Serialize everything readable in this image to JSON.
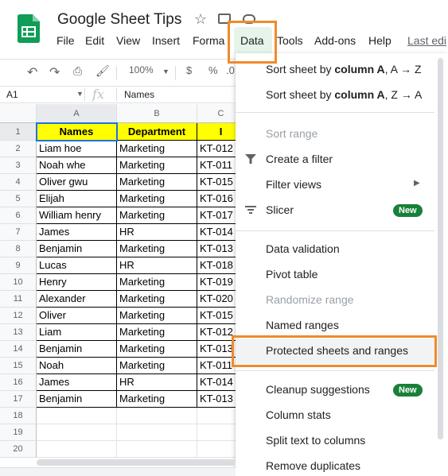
{
  "header": {
    "title": "Google Sheet Tips",
    "last_edit": "Last edi"
  },
  "menubar": {
    "items": [
      "File",
      "Edit",
      "View",
      "Insert",
      "Forma",
      "Data",
      "Tools",
      "Add-ons",
      "Help"
    ],
    "active": "Data"
  },
  "toolbar": {
    "zoom": "100%",
    "currency": "$",
    "percent": "%",
    "decimal": ".0"
  },
  "formula_bar": {
    "cell_ref": "A1",
    "fx": "fx",
    "value": "Names"
  },
  "sheet": {
    "columns": [
      "A",
      "B",
      "C"
    ],
    "row_numbers": [
      "1",
      "2",
      "3",
      "4",
      "5",
      "6",
      "7",
      "8",
      "9",
      "10",
      "11",
      "12",
      "13",
      "14",
      "15",
      "16",
      "17",
      "18",
      "19",
      "20"
    ],
    "header_row": [
      "Names",
      "Department",
      "I"
    ],
    "rows": [
      [
        "Liam hoe",
        "Marketing",
        "KT-012"
      ],
      [
        "Noah whe",
        "Marketing",
        "KT-011"
      ],
      [
        "Oliver gwu",
        "Marketing",
        "KT-015"
      ],
      [
        "Elijah",
        "Marketing",
        "KT-016"
      ],
      [
        "William henry",
        "Marketing",
        "KT-017"
      ],
      [
        "James",
        "HR",
        "KT-014"
      ],
      [
        "Benjamin",
        "Marketing",
        "KT-013"
      ],
      [
        "Lucas",
        "HR",
        "KT-018"
      ],
      [
        "Henry",
        "Marketing",
        "KT-019"
      ],
      [
        "Alexander",
        "Marketing",
        "KT-020"
      ],
      [
        "Oliver",
        "Marketing",
        "KT-015"
      ],
      [
        "Liam",
        "Marketing",
        "KT-012"
      ],
      [
        "Benjamin",
        "Marketing",
        "KT-013"
      ],
      [
        "Noah",
        "Marketing",
        "KT-011"
      ],
      [
        "James",
        "HR",
        "KT-014"
      ],
      [
        "Benjamin",
        "Marketing",
        "KT-013"
      ]
    ]
  },
  "data_menu": {
    "sort_a_z_prefix": "Sort sheet by ",
    "sort_a_z_bold": "column A",
    "sort_a_z_suffix": ", A → Z",
    "sort_z_a_prefix": "Sort sheet by ",
    "sort_z_a_bold": "column A",
    "sort_z_a_suffix": ", Z → A",
    "sort_range": "Sort range",
    "create_filter": "Create a filter",
    "filter_views": "Filter views",
    "slicer": "Slicer",
    "new_badge": "New",
    "data_validation": "Data validation",
    "pivot_table": "Pivot table",
    "randomize_range": "Randomize range",
    "named_ranges": "Named ranges",
    "protected": "Protected sheets and ranges",
    "cleanup": "Cleanup suggestions",
    "column_stats": "Column stats",
    "split_text": "Split text to columns",
    "remove_duplicates": "Remove duplicates"
  },
  "colors": {
    "highlight": "#f08a2c",
    "header_fill": "#ffff00",
    "badge": "#188038",
    "brand": "#0f9d58"
  },
  "icons": [
    "sheets-logo-icon",
    "star-icon",
    "move-to-folder-icon",
    "cloud-status-icon",
    "undo-icon",
    "redo-icon",
    "print-icon",
    "paint-format-icon",
    "filter-icon",
    "slicer-icon",
    "submenu-arrow-icon"
  ]
}
